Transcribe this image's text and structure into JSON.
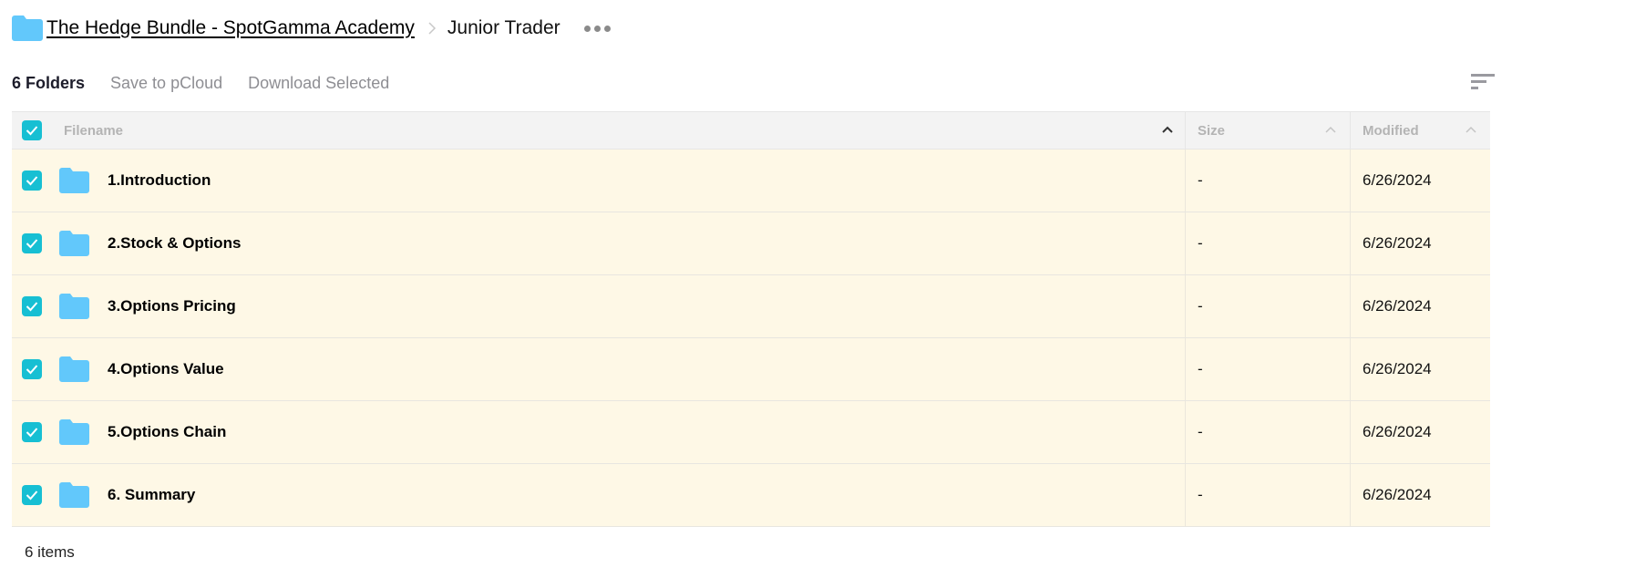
{
  "breadcrumb": {
    "root_icon": "folder-icon",
    "root_label": "The Hedge Bundle - SpotGamma Academy",
    "separator_icon": "chevron-right-icon",
    "current_label": "Junior Trader",
    "more_icon": "more-horizontal-icon"
  },
  "toolbar": {
    "count_label": "6 Folders",
    "save_label": "Save to pCloud",
    "download_label": "Download Selected",
    "sort_icon": "sort-icon"
  },
  "table": {
    "headers": {
      "filename": "Filename",
      "size": "Size",
      "modified": "Modified"
    },
    "select_all_checked": true,
    "rows": [
      {
        "name": "1.Introduction",
        "size": "-",
        "modified": "6/26/2024",
        "checked": true,
        "icon": "folder-icon"
      },
      {
        "name": "2.Stock & Options",
        "size": "-",
        "modified": "6/26/2024",
        "checked": true,
        "icon": "folder-icon"
      },
      {
        "name": "3.Options Pricing",
        "size": "-",
        "modified": "6/26/2024",
        "checked": true,
        "icon": "folder-icon"
      },
      {
        "name": "4.Options Value",
        "size": "-",
        "modified": "6/26/2024",
        "checked": true,
        "icon": "folder-icon"
      },
      {
        "name": "5.Options Chain",
        "size": "-",
        "modified": "6/26/2024",
        "checked": true,
        "icon": "folder-icon"
      },
      {
        "name": "6. Summary",
        "size": "-",
        "modified": "6/26/2024",
        "checked": true,
        "icon": "folder-icon"
      }
    ]
  },
  "footer": {
    "items_label": "6 items"
  },
  "colors": {
    "checkbox": "#17bfd3",
    "folder": "#62c8fb",
    "selected_row": "#fef8e6",
    "header_bg": "#f3f3f3"
  }
}
